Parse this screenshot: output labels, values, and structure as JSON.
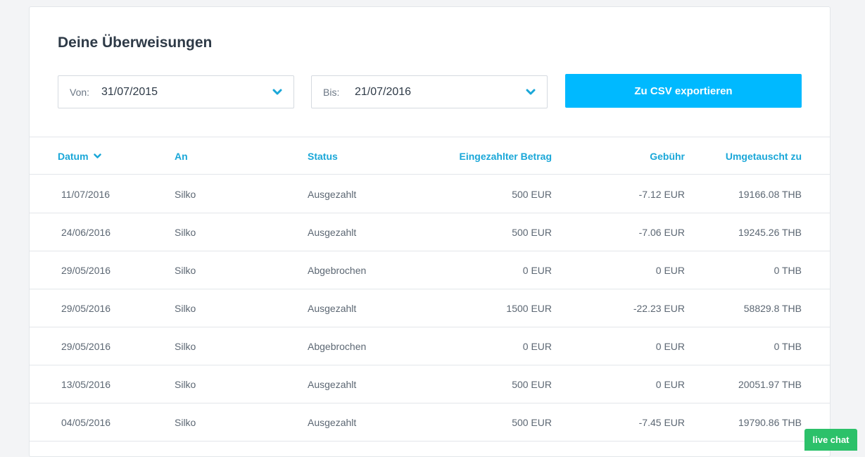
{
  "page": {
    "title": "Deine Überweisungen"
  },
  "filters": {
    "from_label": "Von:",
    "from_value": "31/07/2015",
    "to_label": "Bis:",
    "to_value": "21/07/2016",
    "chevron_icon": "chevron-down-icon"
  },
  "export_button": {
    "label": "Zu CSV exportieren",
    "color": "#00b9ff"
  },
  "table": {
    "headers": {
      "date": "Datum",
      "to": "An",
      "status": "Status",
      "amount": "Eingezahlter Betrag",
      "fee": "Gebühr",
      "converted": "Umgetauscht zu"
    },
    "sort_icon": "chevron-down-icon",
    "rows": [
      {
        "date": "11/07/2016",
        "to": "Silko",
        "status": "Ausgezahlt",
        "amount": "500 EUR",
        "fee": "-7.12 EUR",
        "converted": "19166.08 THB"
      },
      {
        "date": "24/06/2016",
        "to": "Silko",
        "status": "Ausgezahlt",
        "amount": "500 EUR",
        "fee": "-7.06 EUR",
        "converted": "19245.26 THB"
      },
      {
        "date": "29/05/2016",
        "to": "Silko",
        "status": "Abgebrochen",
        "amount": "0 EUR",
        "fee": "0 EUR",
        "converted": "0 THB"
      },
      {
        "date": "29/05/2016",
        "to": "Silko",
        "status": "Ausgezahlt",
        "amount": "1500 EUR",
        "fee": "-22.23 EUR",
        "converted": "58829.8 THB"
      },
      {
        "date": "29/05/2016",
        "to": "Silko",
        "status": "Abgebrochen",
        "amount": "0 EUR",
        "fee": "0 EUR",
        "converted": "0 THB"
      },
      {
        "date": "13/05/2016",
        "to": "Silko",
        "status": "Ausgezahlt",
        "amount": "500 EUR",
        "fee": "0 EUR",
        "converted": "20051.97 THB"
      },
      {
        "date": "04/05/2016",
        "to": "Silko",
        "status": "Ausgezahlt",
        "amount": "500 EUR",
        "fee": "-7.45 EUR",
        "converted": "19790.86 THB"
      }
    ]
  },
  "live_chat": {
    "label": "live chat",
    "color": "#2cc16a"
  }
}
